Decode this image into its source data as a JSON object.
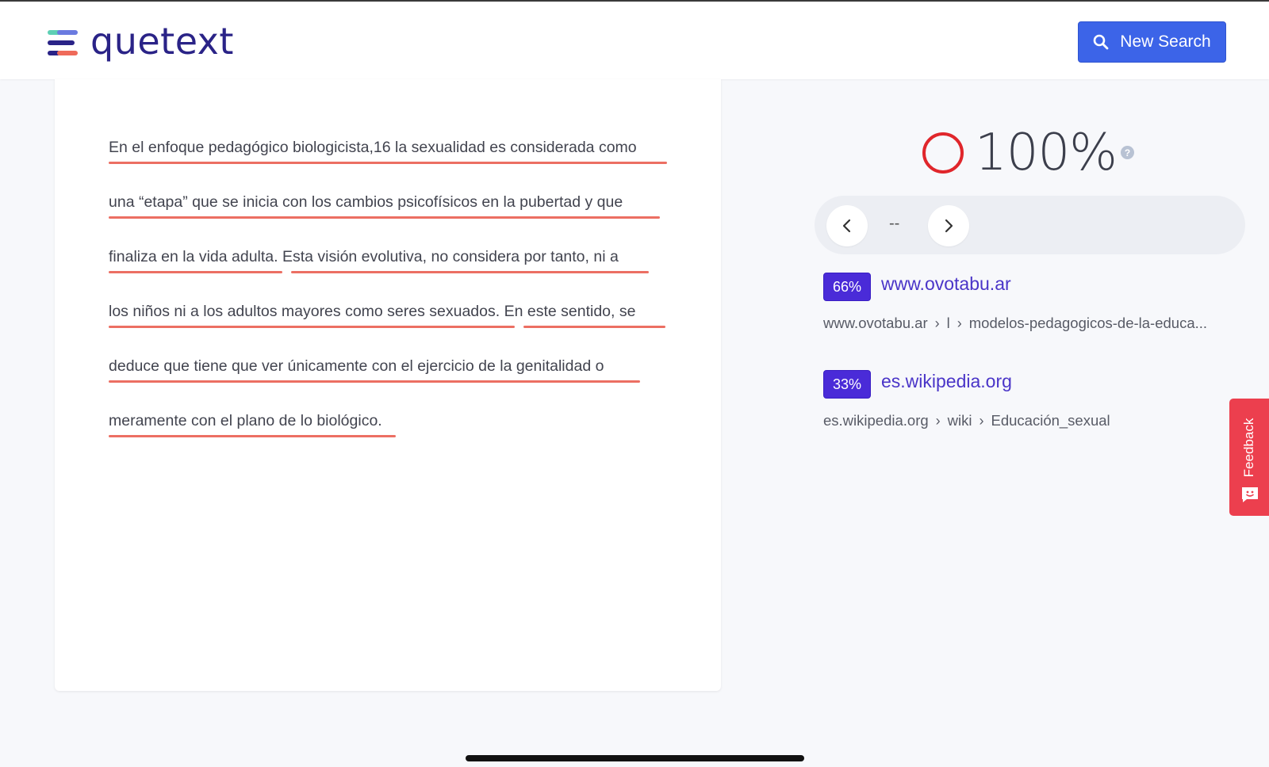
{
  "app": {
    "logo_text": "quetext",
    "new_search_label": "New Search"
  },
  "document": {
    "lines": [
      "En el enfoque pedagógico biologicista,16 la sexualidad es considerada como",
      "una “etapa” que se inicia con los cambios psicofísicos en la pubertad y que",
      "finaliza en la vida adulta. Esta visión evolutiva, no considera por tanto, ni a",
      "los niños ni a los adultos mayores como seres sexuados. En este sentido, se",
      "deduce que tiene que ver únicamente con el ejercicio de la genitalidad o",
      "meramente con el plano de lo biológico."
    ],
    "underline_color": "#ec6f63"
  },
  "results": {
    "score": "100%",
    "score_color": "#e0262b",
    "help_icon": "question-icon",
    "nav_counter": "--",
    "sources": [
      {
        "percent": "66%",
        "domain": "www.ovotabu.ar",
        "path": [
          "www.ovotabu.ar",
          "l",
          "modelos-pedagogicos-de-la-educa..."
        ]
      },
      {
        "percent": "33%",
        "domain": "es.wikipedia.org",
        "path": [
          "es.wikipedia.org",
          "wiki",
          "Educación_sexual"
        ]
      }
    ]
  },
  "feedback": {
    "label": "Feedback"
  },
  "colors": {
    "accent_button": "#3c64e8",
    "badge": "#4a2bd8",
    "link": "#4a35c8",
    "feedback": "#ec3f4e",
    "logo": "#2a2387"
  }
}
